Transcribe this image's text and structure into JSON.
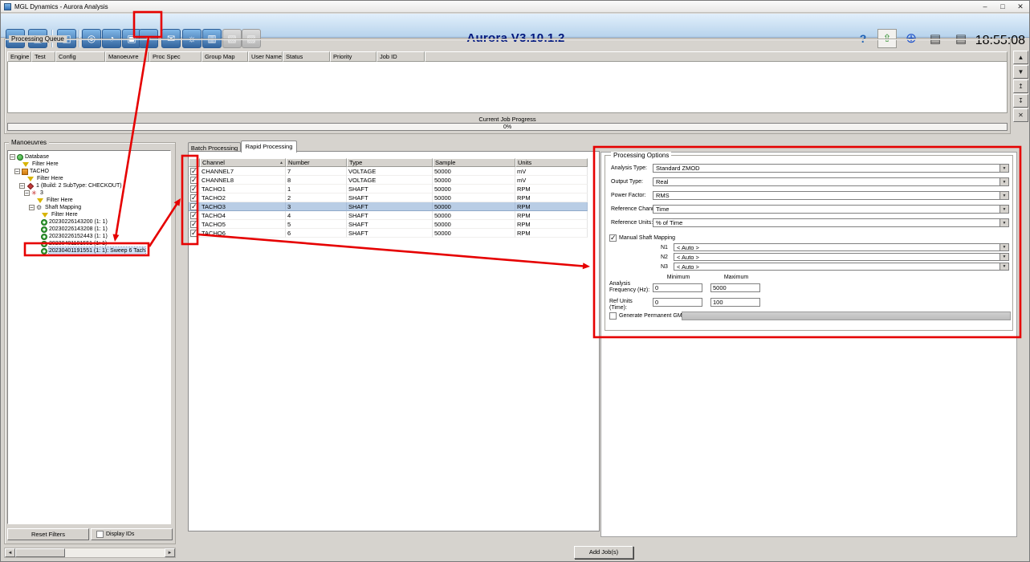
{
  "window": {
    "title": "MGL Dynamics - Aurora Analysis",
    "minimize": "–",
    "maximize": "□",
    "close": "✕"
  },
  "toolbar": {
    "app_title": "Aurora V3.10.1.2",
    "clock": "18:55:08",
    "left_icons": [
      {
        "name": "connect-icon",
        "glyph": "➔"
      },
      {
        "name": "data-table-icon",
        "glyph": "▦"
      },
      {
        "name": "network-icon",
        "glyph": "◫"
      },
      {
        "name": "analysis-icon",
        "glyph": "◎"
      },
      {
        "name": "scope-icon",
        "glyph": "◔"
      },
      {
        "name": "monitor-icon",
        "glyph": "▣"
      },
      {
        "name": "rapid-processing-icon",
        "glyph": "▼"
      },
      {
        "name": "mail-icon",
        "glyph": "✉"
      },
      {
        "name": "ideas-icon",
        "glyph": "☼"
      },
      {
        "name": "chart-icon",
        "glyph": "▥"
      },
      {
        "name": "report-icon",
        "glyph": "▧"
      },
      {
        "name": "export-icon",
        "glyph": "▨"
      }
    ],
    "right_icons": [
      {
        "name": "help-icon",
        "glyph": "?"
      },
      {
        "name": "upload-icon",
        "glyph": "⇧"
      },
      {
        "name": "web-icon",
        "glyph": "⊕"
      },
      {
        "name": "printer-icon",
        "glyph": "▤"
      },
      {
        "name": "print-preview-icon",
        "glyph": "▤"
      }
    ]
  },
  "processing_queue": {
    "label": "Processing Queue",
    "columns": [
      "Engine",
      "Test",
      "Config",
      "Manoeuvre",
      "Proc Spec",
      "Group Map",
      "User Name",
      "Status",
      "Priority",
      "Job ID"
    ],
    "rows": [],
    "progress_label": "Current Job Progress",
    "progress_value": "0%",
    "side_buttons": [
      {
        "name": "queue-up-button",
        "glyph": "▲"
      },
      {
        "name": "queue-down-button",
        "glyph": "▼"
      },
      {
        "name": "queue-top-button",
        "glyph": "↥"
      },
      {
        "name": "queue-bottom-button",
        "glyph": "↧"
      },
      {
        "name": "queue-delete-button",
        "glyph": "✕"
      }
    ]
  },
  "manoeuvres": {
    "label": "Manoeuvres",
    "tree": [
      {
        "label": "Database"
      },
      {
        "label": "Filter Here"
      },
      {
        "label": "TACHO"
      },
      {
        "label": "Filter Here"
      },
      {
        "label": "1 (Build: 2  SubType: CHECKOUT)"
      },
      {
        "label": "3"
      },
      {
        "label": "Filter Here"
      },
      {
        "label": "Shaft Mapping"
      },
      {
        "label": "Filter Here"
      },
      {
        "label": "20230226143200 (1: 1)"
      },
      {
        "label": "20230226143208 (1: 1)"
      },
      {
        "label": "20230226152443 (1: 1)"
      },
      {
        "label": "20230401191551 (1: 1)"
      },
      {
        "label": "20230401191551 (1: 1): Sweep 6 Tach",
        "selected": true
      }
    ],
    "reset_button": "Reset Filters",
    "display_ids_label": "Display IDs",
    "display_ids_checked": false
  },
  "tabs": [
    {
      "label": "Batch Processing"
    },
    {
      "label": "Rapid Processing",
      "active": true
    }
  ],
  "channels": {
    "columns": [
      "Channel",
      "Number",
      "Type",
      "Sample",
      "Units"
    ],
    "rows": [
      {
        "checked": true,
        "channel": "CHANNEL7",
        "number": "7",
        "type": "VOLTAGE",
        "sample": "50000",
        "units": "mV"
      },
      {
        "checked": true,
        "channel": "CHANNEL8",
        "number": "8",
        "type": "VOLTAGE",
        "sample": "50000",
        "units": "mV"
      },
      {
        "checked": true,
        "channel": "TACHO1",
        "number": "1",
        "type": "SHAFT",
        "sample": "50000",
        "units": "RPM"
      },
      {
        "checked": true,
        "channel": "TACHO2",
        "number": "2",
        "type": "SHAFT",
        "sample": "50000",
        "units": "RPM"
      },
      {
        "checked": true,
        "channel": "TACHO3",
        "number": "3",
        "type": "SHAFT",
        "sample": "50000",
        "units": "RPM",
        "selected": true
      },
      {
        "checked": true,
        "channel": "TACHO4",
        "number": "4",
        "type": "SHAFT",
        "sample": "50000",
        "units": "RPM"
      },
      {
        "checked": true,
        "channel": "TACHO5",
        "number": "5",
        "type": "SHAFT",
        "sample": "50000",
        "units": "RPM"
      },
      {
        "checked": true,
        "channel": "TACHO6",
        "number": "6",
        "type": "SHAFT",
        "sample": "50000",
        "units": "RPM"
      }
    ]
  },
  "processing_options": {
    "label": "Processing Options",
    "fields": [
      {
        "label": "Analysis Type:",
        "value": "Standard ZMOD"
      },
      {
        "label": "Output Type:",
        "value": "Real"
      },
      {
        "label": "Power Factor:",
        "value": "RMS"
      },
      {
        "label": "Reference Channel:",
        "value": "Time"
      },
      {
        "label": "Reference Units:",
        "value": "% of Time"
      }
    ],
    "manual_shaft_mapping_label": "Manual Shaft Mapping",
    "manual_shaft_mapping_checked": true,
    "shafts": [
      {
        "label": "N1",
        "value": "< Auto >"
      },
      {
        "label": "N2",
        "value": "< Auto >"
      },
      {
        "label": "N3",
        "value": "< Auto >"
      }
    ],
    "min_header": "Minimum",
    "max_header": "Maximum",
    "ranges": [
      {
        "label": "Analysis Frequency (Hz):",
        "min": "0",
        "max": "5000"
      },
      {
        "label": "Ref Units (Time):",
        "min": "0",
        "max": "100"
      }
    ],
    "generate_label": "Generate Permanent GM/PS",
    "generate_checked": false
  },
  "footer": {
    "add_jobs": "Add Job(s)"
  },
  "colors": {
    "annotation": "#e60000",
    "selection": "#b9cde5",
    "title": "#00177d"
  }
}
